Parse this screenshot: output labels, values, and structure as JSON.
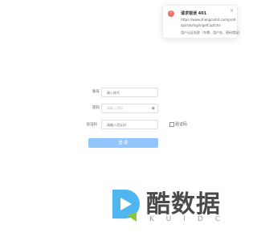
{
  "notification": {
    "icon": "error-circle-icon",
    "title": "请求错误 401",
    "url_line1": "https://www.zhongcaihd.com/prod-",
    "url_line2": "api/sds/login/getCaptcha",
    "message": "用户认证失败（令牌、用户名、密码错误）",
    "close": "×"
  },
  "form": {
    "username": {
      "label": "账号",
      "placeholder": "输入账号"
    },
    "password": {
      "label": "密码",
      "placeholder": "请输入密码"
    },
    "captcha": {
      "label": "验证码",
      "placeholder": "请输入验证码",
      "image_alt": "验证码"
    },
    "submit": "登 录"
  },
  "watermark": {
    "text": "酷数据",
    "subtext": "KUIDC"
  },
  "colors": {
    "error": "#f56c6c",
    "button": "#92c5fc",
    "logo_blue": "#4fb6ef",
    "logo_green": "#8dc63f"
  }
}
